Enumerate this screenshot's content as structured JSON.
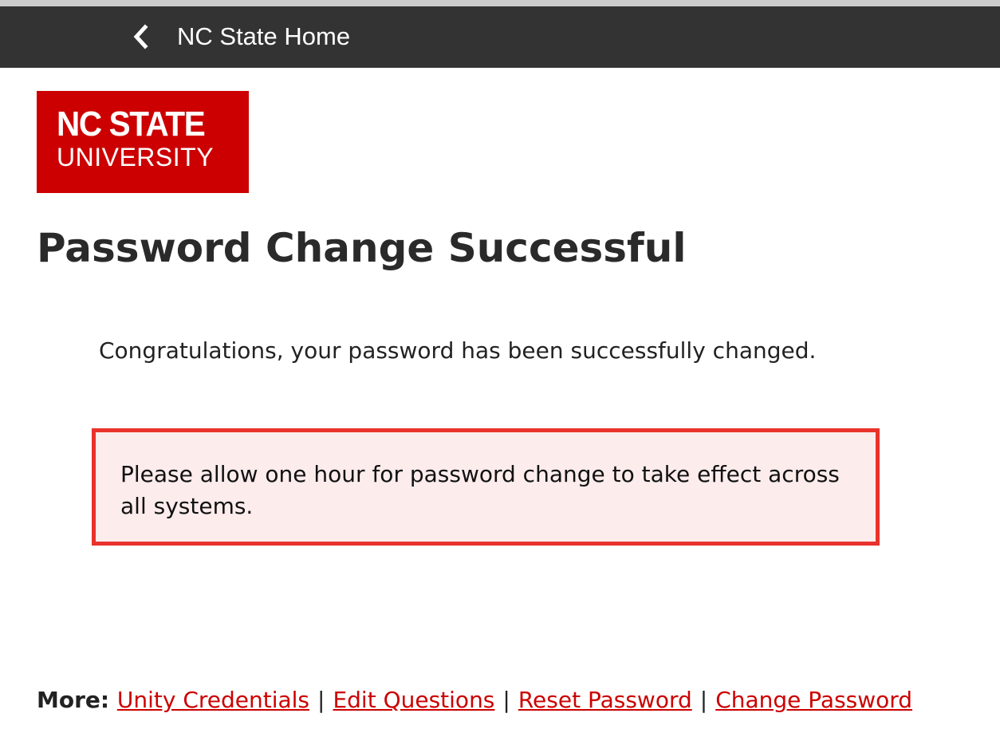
{
  "topbar": {
    "home_label": "NC State Home",
    "home_icon": "chevron-left-icon",
    "background": "#333333"
  },
  "logo": {
    "line1": "NC STATE",
    "line2": "UNIVERSITY",
    "color": "#cc0000"
  },
  "page": {
    "title": "Password Change Successful",
    "message": "Congratulations, your password has been successfully changed."
  },
  "notice": {
    "text": "Please allow one hour for password change to take effect across all systems.",
    "border_color": "#e8322b",
    "background": "#fcecec"
  },
  "footer": {
    "more_label": "More:",
    "links": [
      {
        "label": "Unity Credentials"
      },
      {
        "label": "Edit Questions"
      },
      {
        "label": "Reset Password"
      },
      {
        "label": "Change Password"
      }
    ],
    "separator": "|",
    "link_color": "#cc0000"
  }
}
